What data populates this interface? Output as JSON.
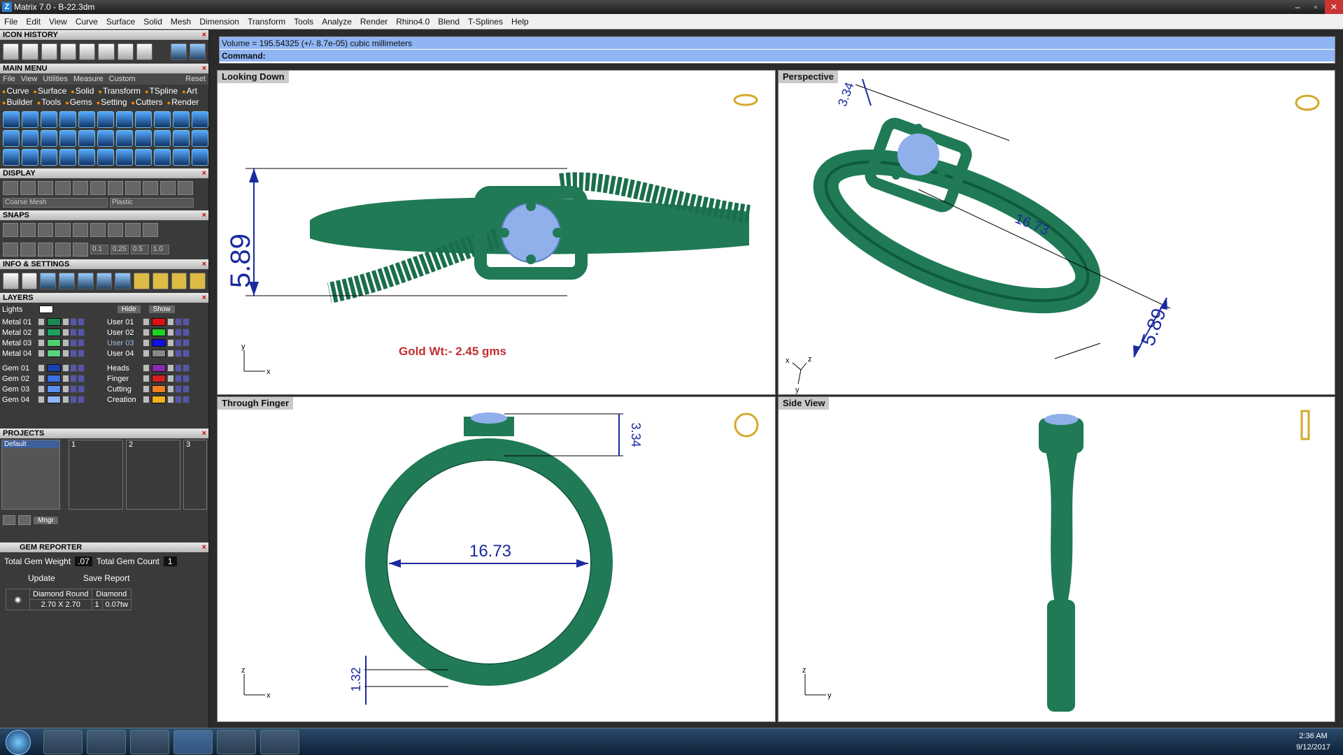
{
  "window": {
    "title": "Matrix 7.0 - B-22.3dm",
    "controls": [
      "–",
      "▫",
      "✕"
    ]
  },
  "menubar": [
    "File",
    "Edit",
    "View",
    "Curve",
    "Surface",
    "Solid",
    "Mesh",
    "Dimension",
    "Transform",
    "Tools",
    "Analyze",
    "Render",
    "Rhino4.0",
    "Blend",
    "T-Splines",
    "Help"
  ],
  "panels": {
    "icon_history": "ICON HISTORY",
    "main_menu": "MAIN MENU",
    "main_links": [
      "File",
      "View",
      "Utilities",
      "Measure",
      "Custom",
      "Reset"
    ],
    "categories": [
      "Curve",
      "Surface",
      "Solid",
      "Transform",
      "TSpline",
      "Art",
      "Builder",
      "Tools",
      "Gems",
      "Setting",
      "Cutters",
      "Render"
    ],
    "display": "DISPLAY",
    "display_mesh": "Coarse Mesh",
    "display_material": "Plastic",
    "snaps": "SNAPS",
    "snap_values": [
      "0.1",
      "0.25",
      "0.5",
      "1.0"
    ],
    "info": "INFO & SETTINGS",
    "layers": "LAYERS",
    "lights": "Lights",
    "hide": "Hide",
    "show": "Show",
    "projects": "PROJECTS",
    "project_default": "Default",
    "project_cols": [
      "1",
      "2",
      "3"
    ],
    "mngr": "Mngr",
    "gem_reporter": "GEM REPORTER"
  },
  "layers_left": [
    {
      "name": "Metal 01",
      "color": "#1a8a50"
    },
    {
      "name": "Metal 02",
      "color": "#20a060"
    },
    {
      "name": "Metal 03",
      "color": "#4ccf70"
    },
    {
      "name": "Metal 04",
      "color": "#5bd080"
    },
    {
      "name": "Gem 01",
      "color": "#1a3fae"
    },
    {
      "name": "Gem 02",
      "color": "#3c6fe0"
    },
    {
      "name": "Gem 03",
      "color": "#5b8ff0"
    },
    {
      "name": "Gem 04",
      "color": "#8fb5f8"
    }
  ],
  "layers_right": [
    {
      "name": "User 01",
      "color": "#e01010"
    },
    {
      "name": "User 02",
      "color": "#20d020"
    },
    {
      "name": "User 03",
      "color": "#1010e0"
    },
    {
      "name": "User 04",
      "color": "#888888"
    },
    {
      "name": "Heads",
      "color": "#8a2ab0"
    },
    {
      "name": "Finger",
      "color": "#d02020"
    },
    {
      "name": "Cutting",
      "color": "#f08020"
    },
    {
      "name": "Creation",
      "color": "#f0b020"
    }
  ],
  "gem": {
    "total_weight_label": "Total Gem Weight",
    "total_weight": ".07",
    "total_count_label": "Total Gem Count",
    "total_count": "1",
    "update": "Update",
    "save_report": "Save Report",
    "h1": "Diamond Round",
    "h2": "Diamond",
    "size": "2.70 X 2.70",
    "qty": "1",
    "tw": "0.07tw"
  },
  "command": {
    "volume": "Volume = 195.54325 (+/- 8.7e-05) cubic millimeters",
    "prompt": "Command:"
  },
  "viewports": {
    "top_left": "Looking Down",
    "top_right": "Perspective",
    "bottom_left": "Through Finger",
    "bottom_right": "Side View",
    "gold_weight": "Gold Wt:- 2.45 gms",
    "dim_height": "5.89",
    "dim_width": "16.73",
    "dim_top": "3.34",
    "dim_shank": "1.32",
    "axes": {
      "x": "x",
      "y": "y",
      "z": "z"
    }
  },
  "taskbar": {
    "time": "2:36 AM",
    "date": "9/12/2017"
  },
  "colors": {
    "metal": "#1f7a55",
    "gem": "#8fb0ea",
    "dim": "#1a2aa0",
    "gold": "#c03030"
  }
}
